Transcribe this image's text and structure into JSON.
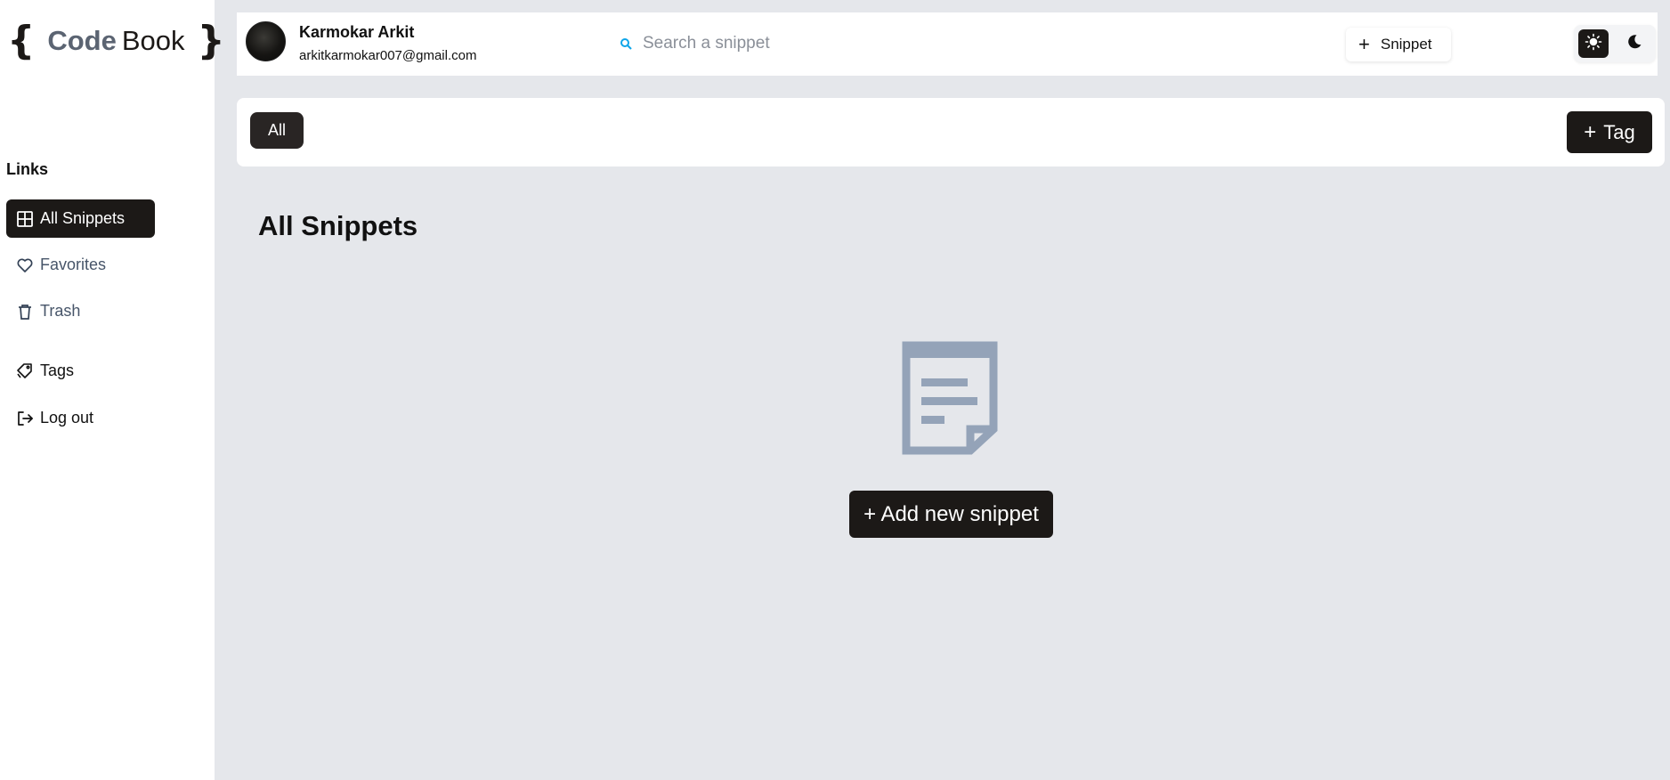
{
  "logo": {
    "brace_open": "{",
    "code": "Code",
    "book": "Book",
    "brace_close": "}"
  },
  "sidebar": {
    "heading": "Links",
    "items": [
      {
        "label": "All Snippets",
        "icon": "grid-icon",
        "active": true
      },
      {
        "label": "Favorites",
        "icon": "heart-icon"
      },
      {
        "label": "Trash",
        "icon": "trash-icon"
      },
      {
        "label": "Tags",
        "icon": "tag-icon"
      },
      {
        "label": "Log out",
        "icon": "logout-icon"
      }
    ]
  },
  "header": {
    "user_name": "Karmokar Arkit",
    "user_email": "arkitkarmokar007@gmail.com",
    "search_placeholder": "Search a snippet",
    "add_snippet_label": "Snippet",
    "plus": "+"
  },
  "tags": {
    "all_label": "All",
    "add_tag_label": "Tag",
    "plus": "+"
  },
  "main": {
    "title": "All Snippets",
    "add_new_label": "+ Add new snippet"
  },
  "colors": {
    "accent": "#1c1917",
    "background": "#e5e7eb",
    "empty_icon": "#94a3b8",
    "search_icon": "#0ea5e9"
  }
}
